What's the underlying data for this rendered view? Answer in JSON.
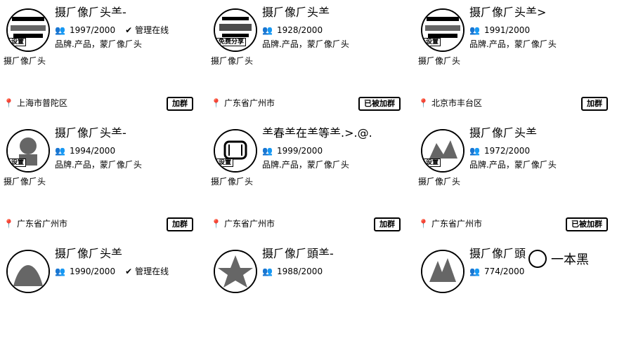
{
  "cards": [
    {
      "title": "摄⺁像⺁头⺷-",
      "count": "1997/2000",
      "managed": "管理在线",
      "meta": "品牌.产品，蒙⺁像⺁头",
      "desc": "摄⺁像⺁头",
      "location": "上海市普陀区",
      "join": "加群",
      "avatar_badge": "设置"
    },
    {
      "title": "摄⺁像⺁头⺷",
      "count": "1928/2000",
      "managed": "",
      "meta": "品牌.产品，蒙⺁像⺁头",
      "desc": "摄⺁像⺁头",
      "location": "广东省广州市",
      "join": "已被加群",
      "avatar_badge": "免费分享"
    },
    {
      "title": "摄⺁像⺁头⺷>",
      "count": "1991/2000",
      "managed": "",
      "meta": "品牌.产品，蒙⺁像⺁头",
      "desc": "摄⺁像⺁头",
      "location": "北京市丰台区",
      "join": "加群",
      "avatar_badge": "设置"
    },
    {
      "title": "摄⺁像⺁头⺷-",
      "count": "1994/2000",
      "managed": "",
      "meta": "品牌.产品，蒙⺁像⺁头",
      "desc": "摄⺁像⺁头",
      "location": "广东省广州市",
      "join": "加群",
      "avatar_badge": "设置"
    },
    {
      "title": "⺷春⺷在⺷等⺷.>.@.",
      "count": "1999/2000",
      "managed": "",
      "meta": "品牌.产品，蒙⺁像⺁头",
      "desc": "摄⺁像⺁头",
      "location": "广东省广州市",
      "join": "加群",
      "avatar_badge": "设置"
    },
    {
      "title": "摄⺁像⺁头⺷",
      "count": "1972/2000",
      "managed": "",
      "meta": "品牌.产品，蒙⺁像⺁头",
      "desc": "摄⺁像⺁头",
      "location": "广东省广州市",
      "join": "已被加群",
      "avatar_badge": "设置"
    },
    {
      "title": "摄⺁像⺁头⺷",
      "count": "1990/2000",
      "managed": "管理在线",
      "meta": "",
      "desc": "",
      "location": "",
      "join": "",
      "avatar_badge": ""
    },
    {
      "title": "摄⺁像⺁頭⺷-",
      "count": "1988/2000",
      "managed": "",
      "meta": "",
      "desc": "",
      "location": "",
      "join": "",
      "avatar_badge": ""
    },
    {
      "title": "摄⺁像⺁頭",
      "count": "774/2000",
      "managed": "",
      "meta": "",
      "desc": "",
      "location": "",
      "join": "",
      "avatar_badge": ""
    }
  ],
  "watermark": {
    "text": "一本黑"
  }
}
